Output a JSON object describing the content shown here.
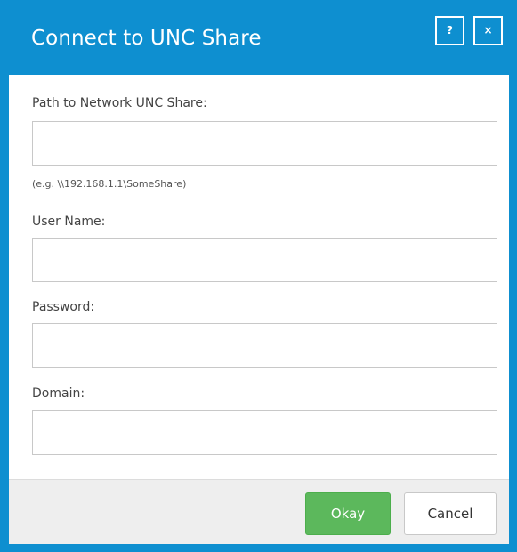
{
  "dialog": {
    "title": "Connect to UNC Share",
    "help_label": "?",
    "close_label": "×"
  },
  "form": {
    "path_label": "Path to Network UNC Share:",
    "path_value": "",
    "path_hint": "(e.g. \\\\192.168.1.1\\SomeShare)",
    "username_label": "User Name:",
    "username_value": "",
    "password_label": "Password:",
    "password_value": "",
    "domain_label": "Domain:",
    "domain_value": ""
  },
  "footer": {
    "okay_label": "Okay",
    "cancel_label": "Cancel"
  },
  "colors": {
    "accent": "#0e8fd0",
    "okay": "#5cb85c"
  }
}
